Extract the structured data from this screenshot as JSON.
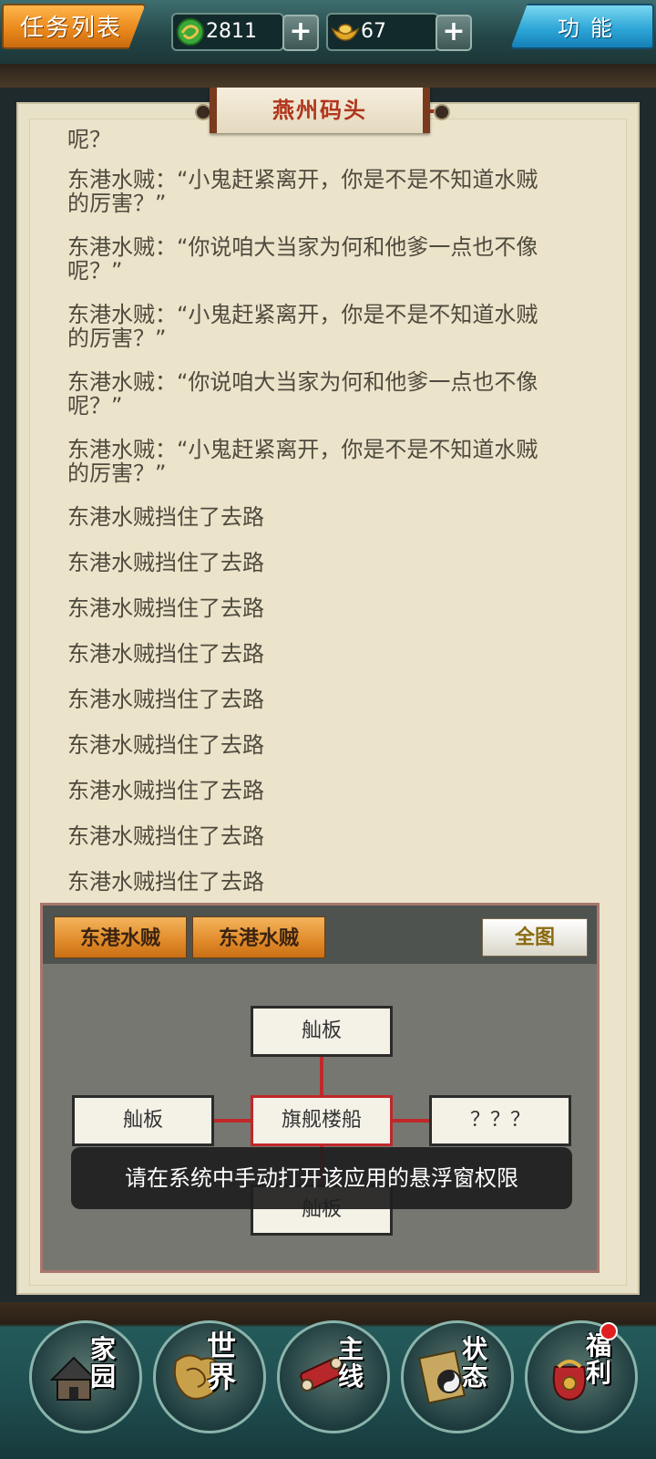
{
  "topbar": {
    "task_list_label": "任务列表",
    "coins": "2811",
    "ingots": "67",
    "plus": "+",
    "function_label": "功能",
    "coin_icon": "dragon-coin-icon",
    "ingot_icon": "gold-ingot-icon"
  },
  "location": {
    "title": "燕州码头"
  },
  "log": {
    "cut_line": "呢？",
    "dialogs": [
      [
        "东港水贼：“小鬼赶紧离开，你是不是不知道水贼",
        "的厉害？”"
      ],
      [
        "东港水贼：“你说咱大当家为何和他爹一点也不像",
        "呢？”"
      ],
      [
        "东港水贼：“小鬼赶紧离开，你是不是不知道水贼",
        "的厉害？”"
      ],
      [
        "东港水贼：“你说咱大当家为何和他爹一点也不像",
        "呢？”"
      ],
      [
        "东港水贼：“小鬼赶紧离开，你是不是不知道水贼",
        "的厉害？”"
      ]
    ],
    "blocked": [
      "东港水贼挡住了去路",
      "东港水贼挡住了去路",
      "东港水贼挡住了去路",
      "东港水贼挡住了去路",
      "东港水贼挡住了去路",
      "东港水贼挡住了去路",
      "东港水贼挡住了去路",
      "东港水贼挡住了去路",
      "东港水贼挡住了去路"
    ]
  },
  "map": {
    "npcs": [
      "东港水贼",
      "东港水贼"
    ],
    "full_map": "全图",
    "rooms": {
      "north": "舢板",
      "west": "舢板",
      "center": "旗舰楼船",
      "east": "？？？",
      "south": "舢板"
    }
  },
  "toast": "请在系统中手动打开该应用的悬浮窗权限",
  "nav": [
    {
      "label": "家园",
      "icon": "home-icon"
    },
    {
      "label": "世界",
      "icon": "world-map-icon"
    },
    {
      "label": "主线",
      "icon": "main-quest-icon"
    },
    {
      "label": "状态",
      "icon": "status-icon"
    },
    {
      "label": "福利",
      "icon": "gift-bag-icon"
    }
  ]
}
